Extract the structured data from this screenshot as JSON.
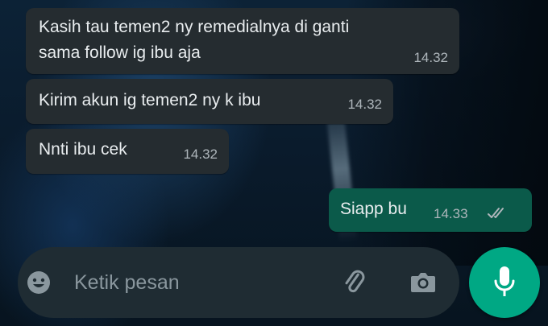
{
  "messages": [
    {
      "direction": "incoming",
      "line1": "Kasih tau temen2 ny remedialnya di ganti",
      "line2": "sama follow ig ibu aja",
      "time": "14.32"
    },
    {
      "direction": "incoming",
      "text": "Kirim akun ig temen2 ny k ibu",
      "time": "14.32"
    },
    {
      "direction": "incoming",
      "text": "Nnti ibu cek",
      "time": "14.32"
    },
    {
      "direction": "outgoing",
      "text": "Siapp bu",
      "time": "14.33",
      "status_icon": "double-check-icon"
    }
  ],
  "composer": {
    "placeholder": "Ketik pesan",
    "emoji_icon": "emoji-icon",
    "attach_icon": "paperclip-icon",
    "camera_icon": "camera-icon"
  },
  "send": {
    "icon": "microphone-icon"
  },
  "colors": {
    "incoming_bubble": "#252c30",
    "outgoing_bubble": "#0b5a4a",
    "composer_bg": "#1f2c33",
    "accent": "#00a884"
  }
}
